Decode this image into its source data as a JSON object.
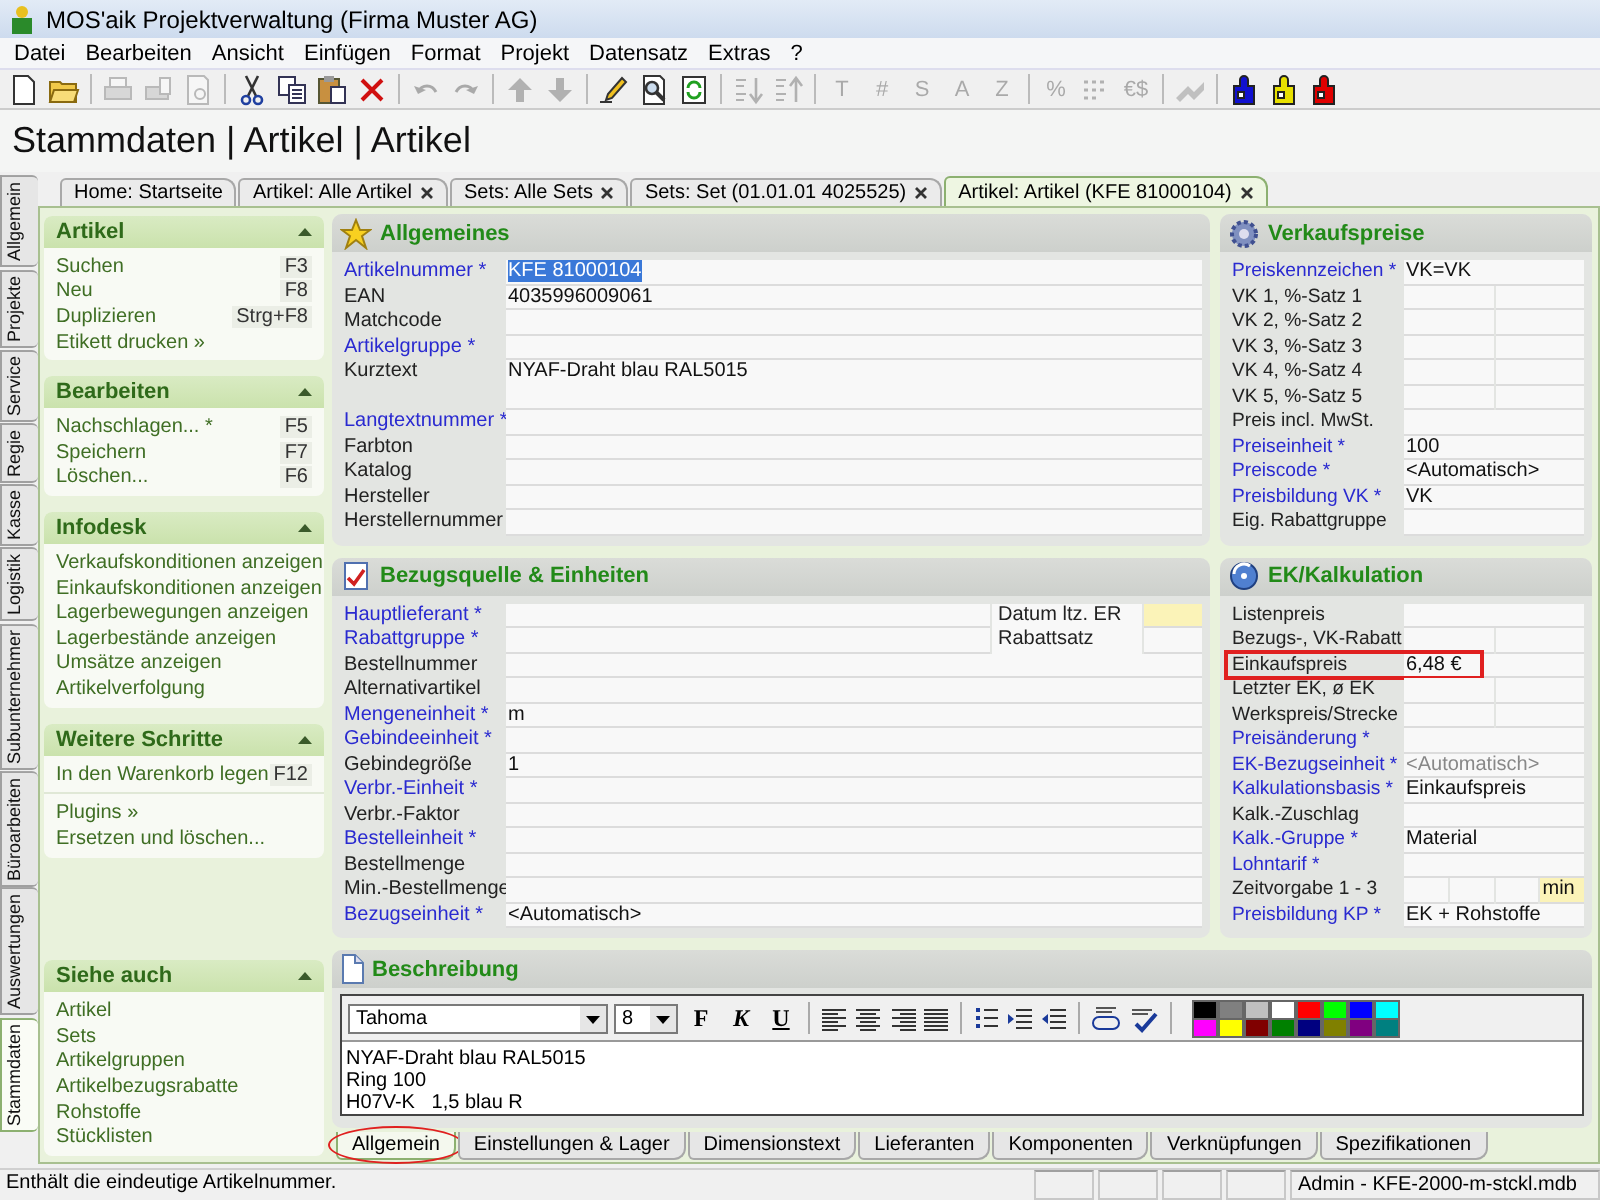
{
  "window": {
    "title": "MOS'aik Projektverwaltung (Firma Muster AG)"
  },
  "menu": [
    {
      "label": "Datei"
    },
    {
      "label": "Bearbeiten"
    },
    {
      "label": "Ansicht"
    },
    {
      "label": "Einfügen"
    },
    {
      "label": "Format"
    },
    {
      "label": "Projekt"
    },
    {
      "label": "Datensatz"
    },
    {
      "label": "Extras"
    },
    {
      "label": "?"
    }
  ],
  "toolbar": [
    {
      "kind": "new",
      "disabled": false
    },
    {
      "kind": "open",
      "disabled": false
    },
    {
      "kind": "separator"
    },
    {
      "kind": "print",
      "disabled": true
    },
    {
      "kind": "print-setup",
      "disabled": true
    },
    {
      "kind": "preview",
      "disabled": true
    },
    {
      "kind": "separator"
    },
    {
      "kind": "cut",
      "disabled": false
    },
    {
      "kind": "copy",
      "disabled": false
    },
    {
      "kind": "paste",
      "disabled": false
    },
    {
      "kind": "delete",
      "disabled": false
    },
    {
      "kind": "separator"
    },
    {
      "kind": "undo",
      "disabled": true
    },
    {
      "kind": "redo",
      "disabled": true
    },
    {
      "kind": "separator"
    },
    {
      "kind": "up",
      "disabled": true
    },
    {
      "kind": "down",
      "disabled": true
    },
    {
      "kind": "separator"
    },
    {
      "kind": "edit",
      "disabled": false
    },
    {
      "kind": "find",
      "disabled": false
    },
    {
      "kind": "refresh",
      "disabled": false
    },
    {
      "kind": "separator"
    },
    {
      "kind": "sort-asc",
      "disabled": true
    },
    {
      "kind": "sort-desc",
      "disabled": true
    },
    {
      "kind": "separator"
    },
    {
      "kind": "glyph",
      "glyph": "T",
      "disabled": true
    },
    {
      "kind": "glyph",
      "glyph": "#",
      "disabled": true
    },
    {
      "kind": "glyph",
      "glyph": "S",
      "disabled": true
    },
    {
      "kind": "glyph",
      "glyph": "A",
      "disabled": true
    },
    {
      "kind": "glyph",
      "glyph": "Z",
      "disabled": true
    },
    {
      "kind": "separator"
    },
    {
      "kind": "glyph",
      "glyph": "%",
      "disabled": true
    },
    {
      "kind": "numbering",
      "disabled": true
    },
    {
      "kind": "glyph",
      "glyph": "€$",
      "disabled": true
    },
    {
      "kind": "separator"
    },
    {
      "kind": "tool",
      "disabled": true
    },
    {
      "kind": "separator"
    },
    {
      "kind": "puzzle",
      "color": "#1010d0",
      "disabled": false
    },
    {
      "kind": "puzzle",
      "color": "#e8e000",
      "disabled": false
    },
    {
      "kind": "puzzle",
      "color": "#e00000",
      "disabled": false
    }
  ],
  "heading": "Stammdaten | Artikel | Artikel",
  "doc_tabs": [
    {
      "label": "Home: Startseite",
      "closable": false,
      "selected": false
    },
    {
      "label": "Artikel: Alle Artikel",
      "closable": true,
      "selected": false
    },
    {
      "label": "Sets: Alle Sets",
      "closable": true,
      "selected": false
    },
    {
      "label": "Sets: Set (01.01.01 4025525)",
      "closable": true,
      "selected": false
    },
    {
      "label": "Artikel: Artikel (KFE 81000104)",
      "closable": true,
      "selected": true
    }
  ],
  "side_tabs": [
    {
      "label": "Allgemein",
      "selected": false
    },
    {
      "label": "Projekte",
      "selected": false
    },
    {
      "label": "Service",
      "selected": false
    },
    {
      "label": "Regie",
      "selected": false
    },
    {
      "label": "Kasse",
      "selected": false
    },
    {
      "label": "Logistik",
      "selected": false
    },
    {
      "label": "Subunternehmer",
      "selected": false
    },
    {
      "label": "Büroarbeiten",
      "selected": false
    },
    {
      "label": "Auswertungen",
      "selected": false
    },
    {
      "label": "Stammdaten",
      "selected": true
    }
  ],
  "task_pane": [
    {
      "title": "Artikel",
      "groups": [
        [
          {
            "label": "Suchen",
            "shortcut": "F3"
          },
          {
            "label": "Neu",
            "shortcut": "F8"
          },
          {
            "label": "Duplizieren",
            "shortcut": "Strg+F8"
          },
          {
            "label": "Etikett drucken »"
          }
        ]
      ]
    },
    {
      "title": "Bearbeiten",
      "groups": [
        [
          {
            "label": "Nachschlagen... *",
            "shortcut": "F5"
          },
          {
            "label": "Speichern",
            "shortcut": "F7"
          },
          {
            "label": "Löschen...",
            "shortcut": "F6"
          }
        ]
      ]
    },
    {
      "title": "Infodesk",
      "groups": [
        [
          {
            "label": "Verkaufskonditionen anzeigen"
          },
          {
            "label": "Einkaufskonditionen anzeigen"
          },
          {
            "label": "Lagerbewegungen anzeigen"
          },
          {
            "label": "Lagerbestände anzeigen"
          },
          {
            "label": "Umsätze anzeigen"
          },
          {
            "label": "Artikelverfolgung"
          }
        ]
      ]
    },
    {
      "title": "Weitere Schritte",
      "groups": [
        [
          {
            "label": "In den Warenkorb legen",
            "shortcut": "F12"
          }
        ],
        [
          {
            "label": "Plugins »"
          },
          {
            "label": "Ersetzen und löschen..."
          }
        ]
      ]
    },
    {
      "title": "Siehe auch",
      "groups": [
        [
          {
            "label": "Artikel"
          },
          {
            "label": "Sets"
          },
          {
            "label": "Artikelgruppen"
          },
          {
            "label": "Artikelbezugsrabatte"
          },
          {
            "label": "Rohstoffe"
          },
          {
            "label": "Stücklisten"
          }
        ]
      ]
    }
  ],
  "main_column": [
    {
      "title": "Allgemeines",
      "fields": [
        {
          "label": "Artikelnummer *",
          "required": true,
          "cells": [
            {
              "value": "KFE 81000104",
              "selected": true
            }
          ]
        },
        {
          "label": "EAN",
          "required": false,
          "cells": [
            {
              "value": "4035996009061"
            }
          ]
        },
        {
          "label": "Matchcode",
          "required": false,
          "cells": [
            {}
          ]
        },
        {
          "label": "Artikelgruppe *",
          "required": true,
          "cells": [
            {}
          ]
        },
        {
          "label": "Kurztext",
          "required": false,
          "tall": true,
          "cells": [
            {
              "value": "NYAF-Draht blau RAL5015"
            }
          ]
        },
        {
          "label": "Langtextnummer *",
          "required": true,
          "cells": [
            {}
          ]
        },
        {
          "label": "Farbton",
          "required": false,
          "cells": [
            {}
          ]
        },
        {
          "label": "Katalog",
          "required": false,
          "cells": [
            {}
          ]
        },
        {
          "label": "Hersteller",
          "required": false,
          "cells": [
            {}
          ]
        },
        {
          "label": "Herstellernummer",
          "required": false,
          "cells": [
            {}
          ]
        }
      ]
    },
    {
      "title": "Bezugsquelle & Einheiten",
      "fields": [
        {
          "label": "Hauptlieferant *",
          "required": true,
          "cells": [
            {}
          ],
          "side": {
            "label": "Datum ltz. ER",
            "highlighted": true
          }
        },
        {
          "label": "Rabattgruppe *",
          "required": true,
          "cells": [
            {}
          ],
          "side": {
            "label": "Rabattsatz",
            "highlighted": false
          }
        },
        {
          "label": "Bestellnummer",
          "required": false,
          "cells": [
            {}
          ]
        },
        {
          "label": "Alternativartikel",
          "required": false,
          "cells": [
            {}
          ]
        },
        {
          "label": "Mengeneinheit *",
          "required": true,
          "cells": [
            {
              "value": "m"
            }
          ]
        },
        {
          "label": "Gebindeeinheit *",
          "required": true,
          "cells": [
            {}
          ]
        },
        {
          "label": "Gebindegröße",
          "required": false,
          "cells": [
            {
              "value": "1"
            }
          ]
        },
        {
          "label": "Verbr.-Einheit *",
          "required": true,
          "cells": [
            {}
          ]
        },
        {
          "label": "Verbr.-Faktor",
          "required": false,
          "cells": [
            {}
          ]
        },
        {
          "label": "Bestelleinheit *",
          "required": true,
          "cells": [
            {}
          ]
        },
        {
          "label": "Bestellmenge",
          "required": false,
          "cells": [
            {}
          ]
        },
        {
          "label": "Min.-Bestellmenge",
          "required": false,
          "cells": [
            {}
          ]
        },
        {
          "label": "Bezugseinheit *",
          "required": true,
          "cells": [
            {
              "value": "<Automatisch>"
            }
          ]
        }
      ]
    }
  ],
  "side_column": [
    {
      "title": "Verkaufspreise",
      "fields": [
        {
          "label": "Preiskennzeichen *",
          "required": true,
          "cells": [
            {
              "value": "VK=VK"
            }
          ]
        },
        {
          "label": "VK 1, %-Satz 1",
          "required": false,
          "cells": [
            {},
            {}
          ]
        },
        {
          "label": "VK 2, %-Satz 2",
          "required": false,
          "cells": [
            {},
            {}
          ]
        },
        {
          "label": "VK 3, %-Satz 3",
          "required": false,
          "cells": [
            {},
            {}
          ]
        },
        {
          "label": "VK 4, %-Satz 4",
          "required": false,
          "cells": [
            {},
            {}
          ]
        },
        {
          "label": "VK 5, %-Satz 5",
          "required": false,
          "cells": [
            {},
            {}
          ]
        },
        {
          "label": "Preis incl. MwSt.",
          "required": false,
          "cells": [
            {}
          ]
        },
        {
          "label": "Preiseinheit *",
          "required": true,
          "cells": [
            {
              "value": "100"
            }
          ]
        },
        {
          "label": "Preiscode *",
          "required": true,
          "cells": [
            {
              "value": "<Automatisch>"
            }
          ]
        },
        {
          "label": "Preisbildung VK *",
          "required": true,
          "cells": [
            {
              "value": "VK"
            }
          ]
        },
        {
          "label": "Eig. Rabattgruppe",
          "required": false,
          "cells": [
            {}
          ]
        }
      ]
    },
    {
      "title": "EK/Kalkulation",
      "fields": [
        {
          "label": "Listenpreis",
          "required": false,
          "cells": [
            {}
          ]
        },
        {
          "label": "Bezugs-, VK-Rabatt",
          "required": false,
          "cells": [
            {},
            {}
          ]
        },
        {
          "label": "Einkaufspreis",
          "required": false,
          "marked": true,
          "cells": [
            {
              "value": "6,48 €"
            }
          ]
        },
        {
          "label": "Letzter EK, ø EK",
          "required": false,
          "cells": [
            {},
            {}
          ]
        },
        {
          "label": "Werkspreis/Strecke",
          "required": false,
          "cells": [
            {},
            {}
          ]
        },
        {
          "label": "Preisänderung *",
          "required": true,
          "cells": [
            {}
          ]
        },
        {
          "label": "EK-Bezugseinheit *",
          "required": true,
          "cells": [
            {
              "value": "<Automatisch>",
              "disabled": true
            }
          ]
        },
        {
          "label": "Kalkulationsbasis *",
          "required": true,
          "cells": [
            {
              "value": "Einkaufspreis"
            }
          ]
        },
        {
          "label": "Kalk.-Zuschlag",
          "required": false,
          "cells": [
            {}
          ]
        },
        {
          "label": "Kalk.-Gruppe *",
          "required": true,
          "cells": [
            {
              "value": "Material"
            }
          ]
        },
        {
          "label": "Lohntarif *",
          "required": true,
          "cells": [
            {}
          ]
        },
        {
          "label": "Zeitvorgabe 1 - 3",
          "required": false,
          "cells": [
            {},
            {},
            {},
            {
              "value": "min",
              "highlighted": true
            }
          ]
        },
        {
          "label": "Preisbildung KP *",
          "required": true,
          "cells": [
            {
              "value": "EK + Rohstoffe"
            }
          ]
        }
      ]
    }
  ],
  "description": {
    "title": "Beschreibung",
    "font": "Tahoma",
    "size": "8",
    "format_buttons": [
      "F",
      "K",
      "U"
    ],
    "colors": [
      {
        "color": "#000000"
      },
      {
        "color": "#808080"
      },
      {
        "color": "#c0c0c0"
      },
      {
        "color": "#ffffff"
      },
      {
        "color": "#ff0000"
      },
      {
        "color": "#00ff00"
      },
      {
        "color": "#0000ff"
      },
      {
        "color": "#00ffff"
      },
      {
        "color": "#ff00ff"
      },
      {
        "color": "#ffff00"
      },
      {
        "color": "#800000"
      },
      {
        "color": "#008000"
      },
      {
        "color": "#000080"
      },
      {
        "color": "#808000"
      },
      {
        "color": "#800080"
      },
      {
        "color": "#008080"
      }
    ],
    "text": [
      "NYAF-Draht blau RAL5015",
      "Ring 100",
      "H07V-K   1,5 blau R"
    ]
  },
  "bottom_tabs": [
    {
      "label": "Allgemein",
      "selected": true,
      "circled": true
    },
    {
      "label": "Einstellungen & Lager",
      "selected": false
    },
    {
      "label": "Dimensionstext",
      "selected": false
    },
    {
      "label": "Lieferanten",
      "selected": false
    },
    {
      "label": "Komponenten",
      "selected": false
    },
    {
      "label": "Verknüpfungen",
      "selected": false
    },
    {
      "label": "Spezifikationen",
      "selected": false
    }
  ],
  "status_bar": {
    "message": "Enthält die eindeutige Artikelnummer.",
    "info": "Admin - KFE-2000-m-stckl.mdb"
  }
}
